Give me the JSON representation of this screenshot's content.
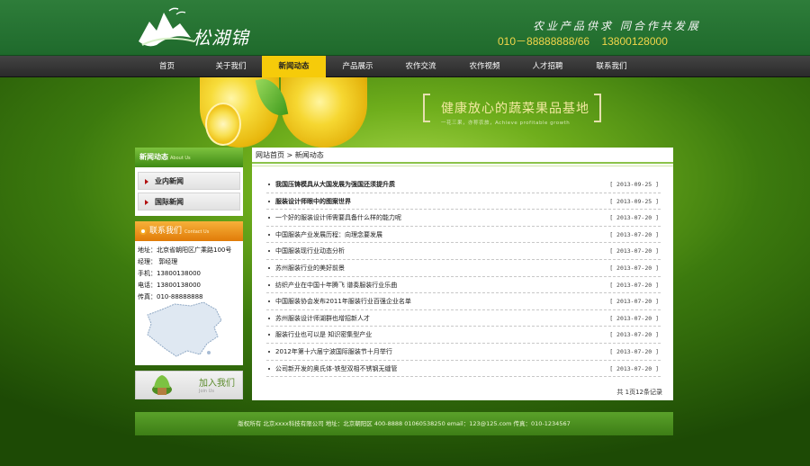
{
  "header": {
    "logo_text": "松湖锦",
    "slogan": "农业产品供求 同合作共发展",
    "phone1": "010－88888888/66",
    "phone2": "13800128000"
  },
  "nav": {
    "items": [
      "首页",
      "关于我们",
      "新闻动态",
      "产品展示",
      "农作交流",
      "农作视频",
      "人才招聘",
      "联系我们"
    ],
    "active_index": 2
  },
  "banner": {
    "title": "健康放心的蔬菜果品基地",
    "subtitle": "一花三果，亦称农旅，Achieve profitable growth"
  },
  "sidebar": {
    "section_title": "新闻动态",
    "section_title_en": "About Us",
    "items": [
      "业内新闻",
      "国际新闻"
    ],
    "contact_title": "联系我们",
    "contact_title_en": "Contact Us",
    "contact": {
      "address": "地址：北京省朝阳区广乘路100号",
      "manager": "经理：  郭经理",
      "mobile": "手机：13800138000",
      "phone": "电话：13800138000",
      "fax": "传真：010-88888888"
    },
    "join_label": "加入我们",
    "join_sub": "Join Us"
  },
  "main": {
    "crumb_home": "网站首页",
    "crumb_sep": ">",
    "crumb_current": "新闻动态",
    "news": [
      {
        "title": "我国压铸模具从大国发展为强国还须提升质",
        "date": "[ 2013-09-25 ]",
        "bold": true
      },
      {
        "title": "服装设计师眼中的图案世界",
        "date": "[ 2013-09-25 ]",
        "bold": true
      },
      {
        "title": "一个好的服装设计师需要具备什么样的能力呢",
        "date": "[ 2013-07-20 ]",
        "bold": false
      },
      {
        "title": "中国服装产业发展历程：向理念要发展",
        "date": "[ 2013-07-20 ]",
        "bold": false
      },
      {
        "title": "中国服装现行业动态分析",
        "date": "[ 2013-07-20 ]",
        "bold": false
      },
      {
        "title": "苏州服装行业的美好前景",
        "date": "[ 2013-07-20 ]",
        "bold": false
      },
      {
        "title": "纺织产业在中国十年腾飞 谱奏服装行业乐曲",
        "date": "[ 2013-07-20 ]",
        "bold": false
      },
      {
        "title": "中国服装协会发布2011年服装行业百强企业名单",
        "date": "[ 2013-07-20 ]",
        "bold": false
      },
      {
        "title": "苏州服装设计师湖群也增招新人才",
        "date": "[ 2013-07-20 ]",
        "bold": false
      },
      {
        "title": "服装行业也可以是 知识密集型产业",
        "date": "[ 2013-07-20 ]",
        "bold": false
      },
      {
        "title": "2012年第十六届宁波国际服装节十月举行",
        "date": "[ 2013-07-20 ]",
        "bold": false
      },
      {
        "title": "公司新开发的奥氏体-铁型双相不锈钢无缝管",
        "date": "[ 2013-07-20 ]",
        "bold": false
      }
    ],
    "pager": "共 1页12条记录"
  },
  "footer": {
    "text": "版权所有 北京xxxx科技有限公司 地址：北京朝阳区  400-8888 01060538250 email：123@125.com 传真：010-1234567"
  },
  "colors": {
    "nav_active": "#f6cb0a",
    "header_green": "#2e7d3a",
    "accent_green": "#8bc34a",
    "contact_orange": "#e07b08"
  }
}
